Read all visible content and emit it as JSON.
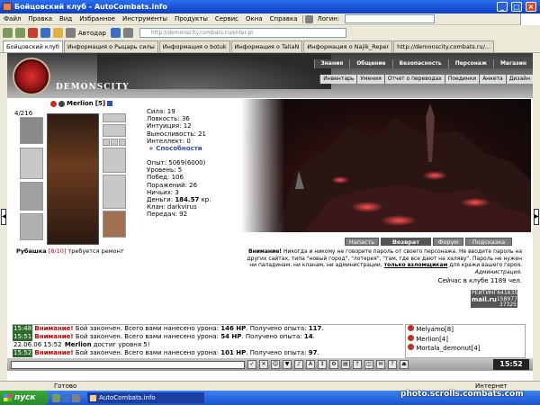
{
  "browser": {
    "title": "Бойцовский клуб - AutoCombats.info",
    "menu": [
      "Файл",
      "Правка",
      "Вид",
      "Избранное",
      "Инструменты",
      "Продукты",
      "Сервис",
      "Окна",
      "Справка"
    ],
    "login_label": "Логин:",
    "address": "http://demonscity.combats.ru/enter.pl",
    "autodar": "Автодар",
    "tabs": [
      "Бойцовский клуб",
      "Информация о Рыцарь силы",
      "Информация о botuk",
      "Информация о TaliaN",
      "Информация о Najik_Reper",
      "http://demonscity.combats.ru/..."
    ],
    "status_text": "Готово",
    "zone_text": "Интернет"
  },
  "site": {
    "logo": "DEMONSCITY",
    "top_nav": [
      "Знания",
      "Общение",
      "Безопасность",
      "Персонаж",
      "Магазин"
    ],
    "sub_nav": [
      "Инвентарь",
      "Умения",
      "Отчет о переводах",
      "Поединки",
      "Анкета",
      "Дизайн"
    ]
  },
  "character": {
    "counter": "4/216",
    "nick": "Merlion",
    "level": "[5]",
    "shirt_label": "Рубашка",
    "shirt_dur": "[8/10]",
    "shirt_note": "требуется ремонт",
    "stats": [
      "Сила: 19",
      "Ловкость: 36",
      "Интуиция: 12",
      "Выносливость: 21",
      "Интеллект: 0"
    ],
    "abilities_link": "+ Способности",
    "info": [
      "Опыт: 5069(6000)",
      "Уровень: 5",
      "Побед: 106",
      "Поражений: 26",
      "Ничьих: 3"
    ],
    "money_label": "Деньги:",
    "money_value": "184.57",
    "money_unit": "кр.",
    "clan": "Клан: darkvirus",
    "transfers": "Передач: 92",
    "hp_fraction": 0.7
  },
  "scene": {
    "buttons": [
      "Напасть",
      "Возврат",
      "Форум",
      "Подсказка"
    ]
  },
  "warning": {
    "bold": "Внимание!",
    "text": " Никогда и никому не говорите пароль от своего персонажа. Не вводите пароль на других сайтах, типа \"новый город\", \"лотерея\", \"там, где все дают на халяву\". Пароль не нужен ни паладинам, ни кланам, ни администрации,",
    "link": "только взломщикам",
    "tail": " для кражи вашего героя.",
    "sign": "Администрация.",
    "online": "Сейчас в клубе 1189 чел."
  },
  "counter_badge": {
    "top": "РЕЙТИНГ",
    "l1": "64163574",
    "brand": "mail.ru",
    "l2": "1589779",
    "l3": "37325"
  },
  "chat": [
    {
      "time": "15:48",
      "warn": "Внимание!",
      "text": " Бой закончен. Всего вами нанесено урона: ",
      "hp": "146 HP",
      "tail": ". Получено опыта: ",
      "exp": "117",
      "end": "."
    },
    {
      "time": "15:51",
      "warn": "Внимание!",
      "text": " Бой закончен. Всего вами нанесено урона: ",
      "hp": "54 HP",
      "tail": ". Получено опыта: ",
      "exp": "14",
      "end": "."
    },
    {
      "time": "22.06.06 15:52",
      "name": "Merlion",
      "text": " достиг уровня 5!"
    },
    {
      "time": "15:52",
      "warn": "Внимание!",
      "text": " Бой закончен. Всего вами нанесено урона: ",
      "hp": "101 HP",
      "tail": ". Получено опыта: ",
      "exp": "97",
      "end": "."
    }
  ],
  "players": [
    "Melyamo[8]",
    "Merlion[4]",
    "Mortala_demonut[4]"
  ],
  "clock": "15:52",
  "taskbar": {
    "start": "пуск",
    "task": "AutoCombats.info",
    "watermark": "photo.scrolls.combats.com"
  }
}
